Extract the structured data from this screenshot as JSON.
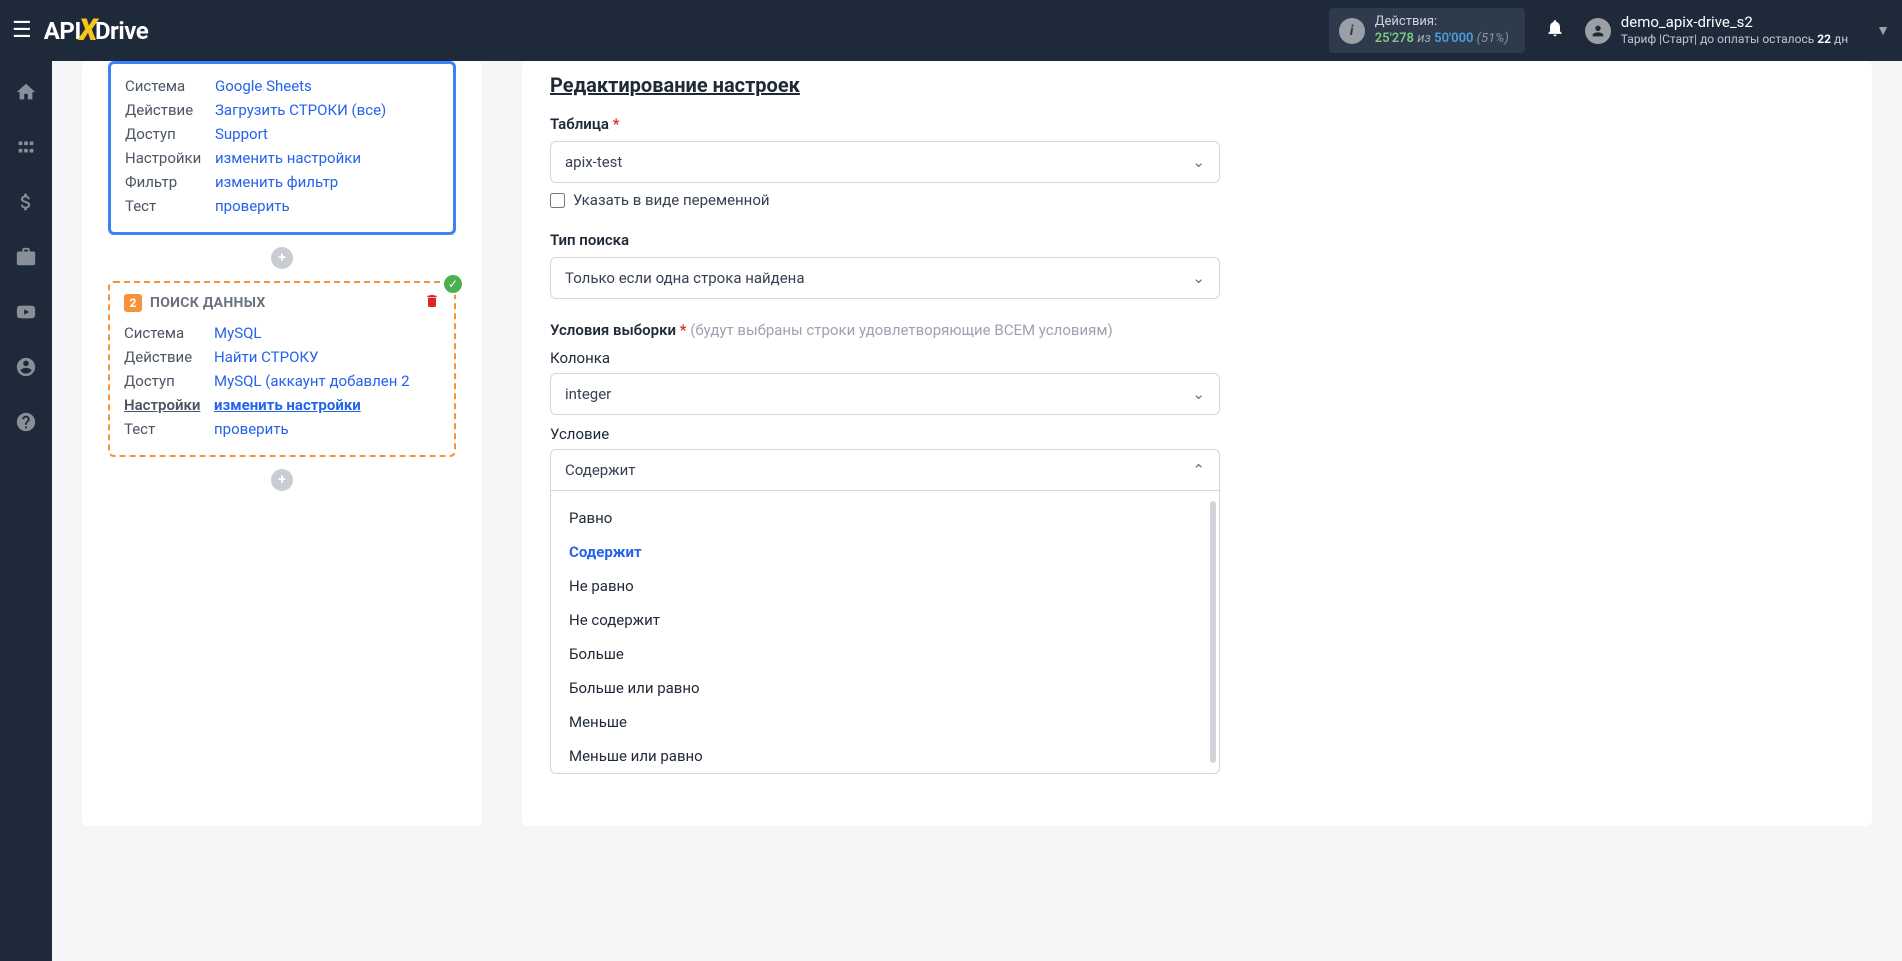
{
  "header": {
    "logo_part1": "API",
    "logo_part2": "Drive",
    "actions_label": "Действия:",
    "actions_count": "25'278",
    "actions_sep": "из",
    "actions_total": "50'000",
    "actions_pct": "(51%)",
    "username": "demo_apix-drive_s2",
    "tariff_prefix": "Тариф |Старт| до оплаты осталось ",
    "tariff_days": "22",
    "tariff_suffix": " дн"
  },
  "step1": {
    "sys_key": "Система",
    "sys_val": "Google Sheets",
    "act_key": "Действие",
    "act_val": "Загрузить СТРОКИ (все)",
    "acc_key": "Доступ",
    "acc_val": "Support",
    "set_key": "Настройки",
    "set_val": "изменить настройки",
    "fil_key": "Фильтр",
    "fil_val": "изменить фильтр",
    "tst_key": "Тест",
    "tst_val": "проверить"
  },
  "step2": {
    "num": "2",
    "title": "ПОИСК ДАННЫХ",
    "sys_key": "Система",
    "sys_val": "MySQL",
    "act_key": "Действие",
    "act_val": "Найти СТРОКУ",
    "acc_key": "Доступ",
    "acc_val": "MySQL (аккаунт добавлен 2",
    "set_key": "Настройки",
    "set_val": "изменить настройки",
    "tst_key": "Тест",
    "tst_val": "проверить"
  },
  "form": {
    "title": "Редактирование настроек",
    "table_label": "Таблица",
    "table_value": "apix-test",
    "var_checkbox": "Указать в виде переменной",
    "search_type_label": "Тип поиска",
    "search_type_value": "Только если одна строка найдена",
    "conditions_label": "Условия выборки",
    "conditions_hint": "(будут выбраны строки удовлетворяющие ВСЕМ условиям)",
    "column_label": "Колонка",
    "column_value": "integer",
    "condition_label": "Условие",
    "condition_value": "Содержит",
    "options": [
      "Равно",
      "Содержит",
      "Не равно",
      "Не содержит",
      "Больше",
      "Больше или равно",
      "Меньше",
      "Меньше или равно"
    ]
  }
}
